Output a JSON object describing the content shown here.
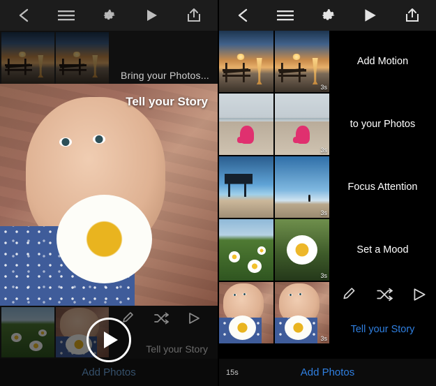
{
  "left_panel": {
    "toolbar": {
      "back_icon": "chevron-left-icon",
      "menu_icon": "hamburger-menu-icon",
      "settings_icon": "gear-icon",
      "play_icon": "play-icon",
      "share_icon": "share-export-icon"
    },
    "top_caption": "Bring your Photos...",
    "preview_caption": "Tell your Story",
    "bottom_caption": "Tell your Story",
    "tools": {
      "edit_icon": "pencil-edit-icon",
      "shuffle_icon": "shuffle-icon",
      "play_icon": "play-triangle-icon"
    },
    "play_button_icon": "play-circle-icon",
    "footer_label": "Add Photos"
  },
  "right_panel": {
    "toolbar": {
      "back_icon": "chevron-left-icon",
      "menu_icon": "hamburger-menu-icon",
      "settings_icon": "gear-icon",
      "play_icon": "play-icon",
      "share_icon": "share-export-icon"
    },
    "rows": [
      {
        "id": "row-sunset",
        "label": "Add Motion",
        "accent": false,
        "duration": "3s",
        "thumbs": [
          "sunset-bench-photo",
          "sunset-bench-photo-2"
        ]
      },
      {
        "id": "row-beach",
        "label": "to your Photos",
        "accent": false,
        "duration": "3s",
        "thumbs": [
          "beach-child-photo",
          "beach-child-photo-2"
        ]
      },
      {
        "id": "row-tower",
        "label": "Focus Attention",
        "accent": false,
        "duration": "3s",
        "thumbs": [
          "lifeguard-tower-photo",
          "beach-horizon-photo"
        ]
      },
      {
        "id": "row-daisies",
        "label": "Set a Mood",
        "accent": false,
        "duration": "3s",
        "thumbs": [
          "daisy-field-photo",
          "daisy-closeup-photo"
        ]
      },
      {
        "id": "row-girl",
        "label": "Tell your Story",
        "accent": true,
        "duration": "3s",
        "thumbs": [
          "girl-with-daisy-photo",
          "girl-with-daisy-photo-2"
        ]
      }
    ],
    "row_tools": {
      "edit_icon": "pencil-edit-icon",
      "shuffle_icon": "shuffle-icon",
      "play_icon": "play-triangle-icon"
    },
    "total_duration": "15s",
    "footer_label": "Add Photos"
  },
  "colors": {
    "accent_blue": "#2f7fe0",
    "toolbar_bg": "#1c1c1c",
    "panel_bg": "#000000",
    "icon_gray": "#bdbdbd"
  }
}
